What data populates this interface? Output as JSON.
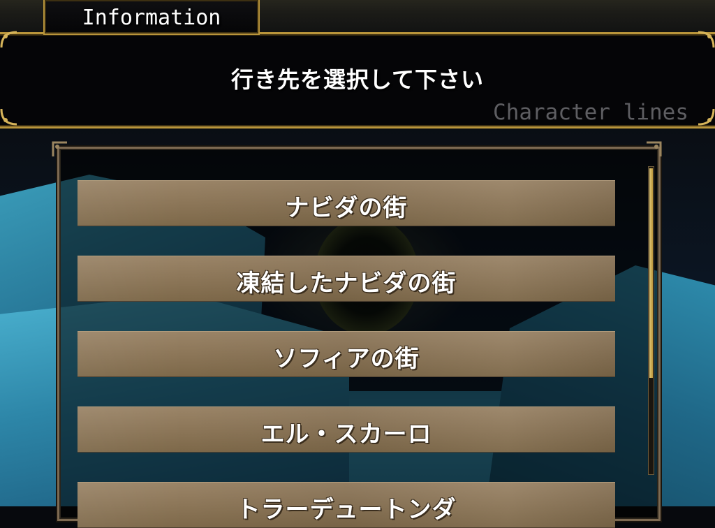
{
  "info": {
    "tab_title": "Information",
    "message": "行き先を選択して下さい",
    "watermark": "Character lines"
  },
  "destinations": [
    {
      "label": "ナビダの街"
    },
    {
      "label": "凍結したナビダの街"
    },
    {
      "label": "ソフィアの街"
    },
    {
      "label": "エル・スカーロ"
    },
    {
      "label": "トラーデュートンダ"
    }
  ],
  "scroll": {
    "position_fraction": 0.0
  },
  "colors": {
    "frame_gold": "#b9953b",
    "button_tan": "#8c7658",
    "panel_black": "#050507",
    "watermark_gray": "#5e5e62"
  },
  "icons": [
    "corner-ornament-icon"
  ]
}
